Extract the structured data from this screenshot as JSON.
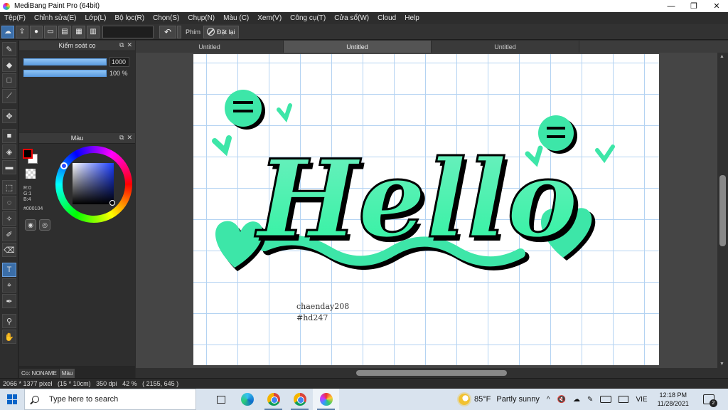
{
  "window": {
    "title": "MediBang Paint Pro (64bit)",
    "minimize": "—",
    "maximize": "❐",
    "close": "✕"
  },
  "menu": [
    "Tệp(F)",
    "Chỉnh sửa(E)",
    "Lớp(L)",
    "Bộ lọc(R)",
    "Chọn(S)",
    "Chụp(N)",
    "Màu (C)",
    "Xem(V)",
    "Công cụ(T)",
    "Cửa sổ(W)",
    "Cloud",
    "Help"
  ],
  "optionbar": {
    "label": "Phím",
    "reset_label": "Đặt lại"
  },
  "brush_panel": {
    "title": "Kiểm soát cọ",
    "size_value": "1000",
    "opacity_value": "100 %",
    "size_fraction": 1.0,
    "opacity_fraction": 1.0
  },
  "color_panel": {
    "title": "Màu",
    "r": "R:0",
    "g": "G:1",
    "b": "B:4",
    "hex": "#000104",
    "fg_color": "#000104"
  },
  "panel_tabs": [
    "Co: NONAME",
    "Màu"
  ],
  "document_tabs": [
    "Untitled",
    "Untitled",
    "Untitled"
  ],
  "canvas": {
    "signature_line1": "chaenday208",
    "signature_line2": "#hd247",
    "art_text": "Hello",
    "art_color": "#3de6a8"
  },
  "status": {
    "text": "2066 * 1377 pixel   (15 * 10cm)   350 dpi   42 %   ( 2155, 645 )"
  },
  "taskbar": {
    "search_placeholder": "Type here to search",
    "weather_temp": "85°F",
    "weather_desc": "Partly sunny",
    "language": "VIE",
    "time": "12:18 PM",
    "date": "11/28/2021",
    "notification_count": "2"
  }
}
